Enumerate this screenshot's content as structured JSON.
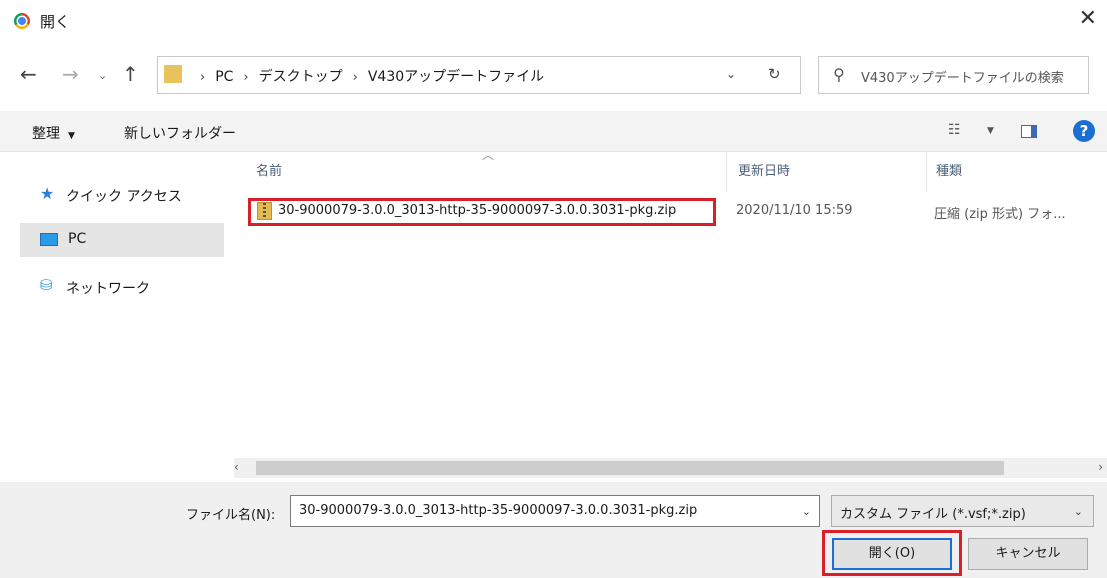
{
  "window": {
    "title": "開く",
    "close_glyph": "✕"
  },
  "nav": {
    "breadcrumb": [
      "PC",
      "デスクトップ",
      "V430アップデートファイル"
    ],
    "search_placeholder": "V430アップデートファイルの検索"
  },
  "toolbar": {
    "organize": "整理",
    "new_folder": "新しいフォルダー"
  },
  "sidebar": {
    "items": [
      {
        "label": "クイック アクセス",
        "icon": "star-icon"
      },
      {
        "label": "PC",
        "icon": "monitor-icon",
        "selected": true
      },
      {
        "label": "ネットワーク",
        "icon": "network-icon"
      }
    ]
  },
  "file_list": {
    "columns": [
      "名前",
      "更新日時",
      "種類"
    ],
    "rows": [
      {
        "name": "30-9000079-3.0.0_3013-http-35-9000097-3.0.0.3031-pkg.zip",
        "modified": "2020/11/10 15:59",
        "type": "圧縮 (zip 形式) フォ...",
        "highlighted": true
      }
    ]
  },
  "bottom": {
    "filename_label": "ファイル名(N):",
    "filename_value": "30-9000079-3.0.0_3013-http-35-9000097-3.0.0.3031-pkg.zip",
    "filetype_value": "カスタム ファイル (*.vsf;*.zip)",
    "open_button": "開く(O)",
    "cancel_button": "キャンセル"
  },
  "colors": {
    "highlight": "#d9202a",
    "accent": "#1a6fd0"
  }
}
